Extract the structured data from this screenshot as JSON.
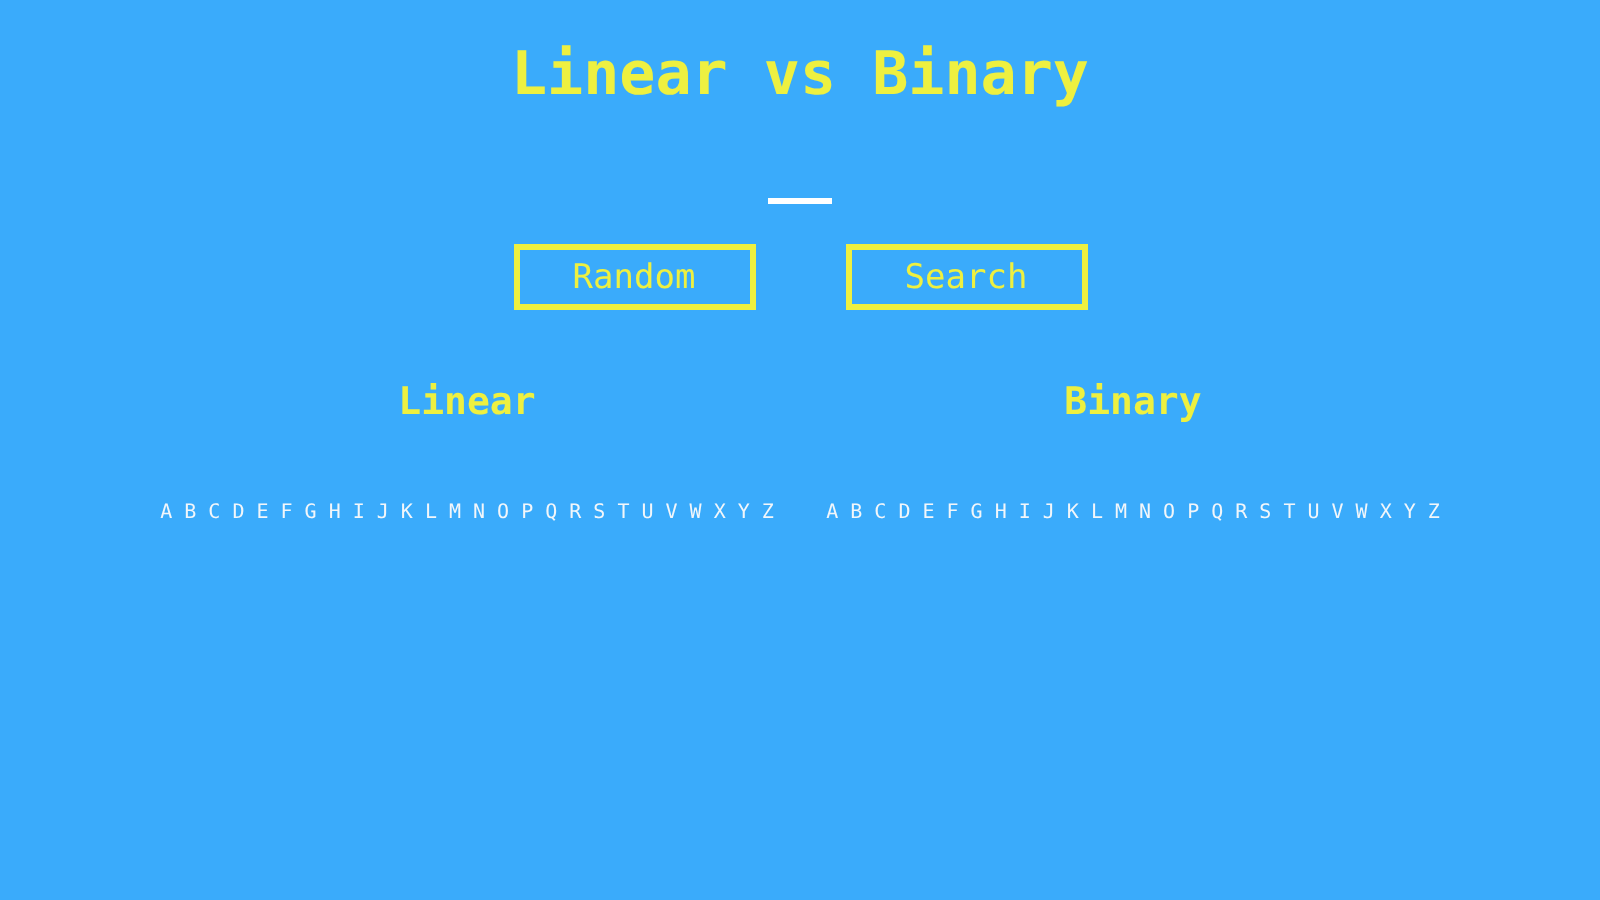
{
  "title": "Linear vs Binary",
  "buttons": [
    "Random",
    "Search"
  ],
  "panels": [
    {
      "heading": "Linear",
      "letters": [
        "A",
        "B",
        "C",
        "D",
        "E",
        "F",
        "G",
        "H",
        "I",
        "J",
        "K",
        "L",
        "M",
        "N",
        "O",
        "P",
        "Q",
        "R",
        "S",
        "T",
        "U",
        "V",
        "W",
        "X",
        "Y",
        "Z"
      ]
    },
    {
      "heading": "Binary",
      "letters": [
        "A",
        "B",
        "C",
        "D",
        "E",
        "F",
        "G",
        "H",
        "I",
        "J",
        "K",
        "L",
        "M",
        "N",
        "O",
        "P",
        "Q",
        "R",
        "S",
        "T",
        "U",
        "V",
        "W",
        "X",
        "Y",
        "Z"
      ]
    }
  ]
}
